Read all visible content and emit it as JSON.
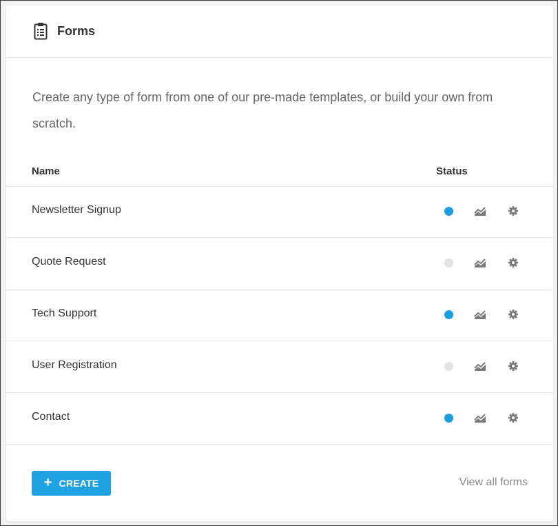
{
  "header": {
    "title": "Forms",
    "icon": "clipboard-icon"
  },
  "description": "Create any type of form from one of our pre-made templates, or build your own from scratch.",
  "table": {
    "columns": [
      "Name",
      "Status"
    ],
    "rows": [
      {
        "name": "Newsletter Signup",
        "active": true
      },
      {
        "name": "Quote Request",
        "active": false
      },
      {
        "name": "Tech Support",
        "active": true
      },
      {
        "name": "User Registration",
        "active": false
      },
      {
        "name": "Contact",
        "active": true
      }
    ]
  },
  "footer": {
    "create_label": "CREATE",
    "create_icon": "plus-icon",
    "view_all_label": "View all forms"
  },
  "colors": {
    "accent": "#1fa2e2",
    "status_on": "#1a9ee0",
    "status_off": "#e3e3e3"
  }
}
